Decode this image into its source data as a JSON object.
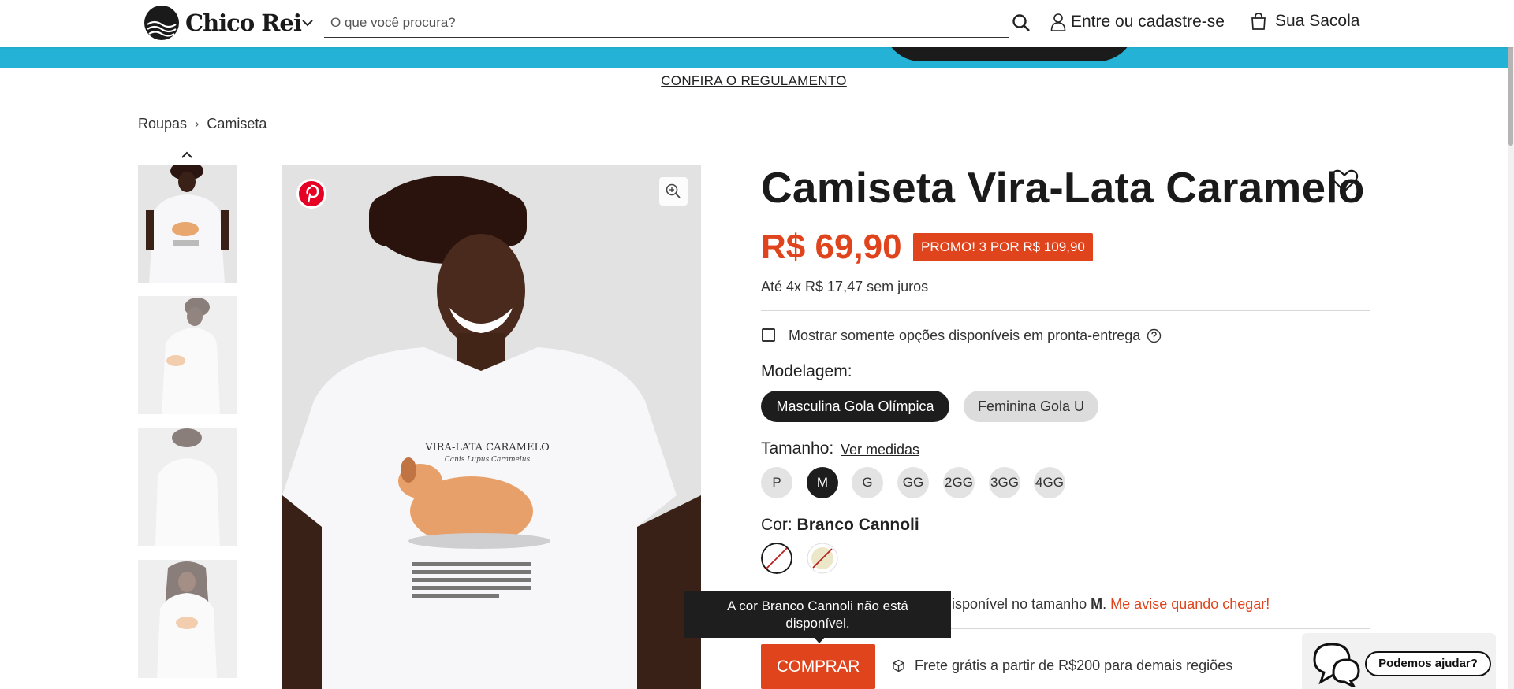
{
  "header": {
    "logo_text": "Chico Rei",
    "search_placeholder": "O que você procura?",
    "login_label": "Entre ou cadastre-se",
    "bag_label": "Sua Sacola"
  },
  "banner": {
    "link_label": "CONFIRA O REGULAMENTO"
  },
  "breadcrumb": {
    "items": [
      "Roupas",
      "Camiseta"
    ],
    "separator": "›"
  },
  "product": {
    "title": "Camiseta Vira-Lata Caramelo",
    "price": "R$ 69,90",
    "promo": "PROMO! 3 POR R$ 109,90",
    "installments": "Até 4x R$ 17,47 sem juros",
    "stock_filter_label": "Mostrar somente opções disponíveis em pronta-entrega",
    "modelagem_label": "Modelagem:",
    "modelagem_options": [
      "Masculina Gola Olímpica",
      "Feminina Gola U"
    ],
    "modelagem_selected": "Masculina Gola Olímpica",
    "tamanho_label": "Tamanho:",
    "ver_medidas": "Ver medidas",
    "sizes": [
      "P",
      "M",
      "G",
      "GG",
      "2GG",
      "3GG",
      "4GG"
    ],
    "size_selected": "M",
    "cor_label": "Cor:",
    "cor_selected": "Branco Cannoli",
    "stock_message_start": "disponível no tamanho",
    "stock_message_size": "M",
    "stock_message_end": ".",
    "notify_link": "Me avise quando chegar!",
    "tooltip_line1": "A cor Branco Cannoli não está",
    "tooltip_line2": "disponível.",
    "buy_label": "COMPRAR",
    "shipping_text": "Frete grátis a partir de R$200 para demais regiões"
  },
  "image_text": {
    "shirt_title": "VIRA-LATA CARAMELO",
    "shirt_subtitle": "Canis Lupus Caramelus"
  },
  "chat": {
    "label": "Podemos ajudar?"
  },
  "colors": {
    "accent": "#e0441c",
    "banner": "#24b3d6",
    "dark": "#1d1d1d"
  }
}
